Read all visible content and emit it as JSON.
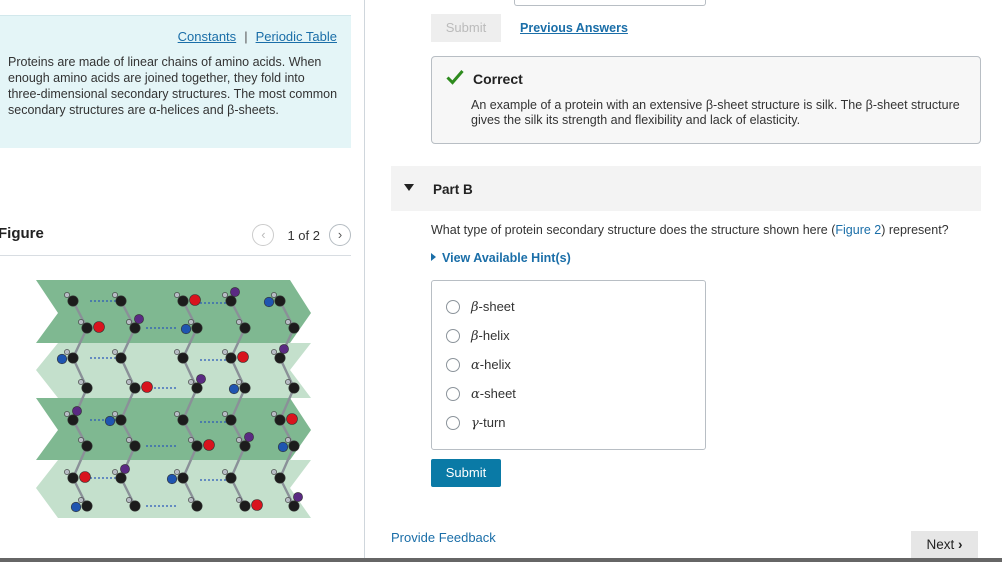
{
  "intro": {
    "links": [
      "Constants",
      "Periodic Table"
    ],
    "separator": "|",
    "text": "Proteins are made of linear chains of amino acids. When enough amino acids are joined together, they fold into three-dimensional secondary structures. The most common secondary structures are α-helices and β-sheets."
  },
  "figure": {
    "title": "Figure",
    "pager_text": "1 of 2",
    "prev_icon": "chevron-left-icon",
    "next_icon": "chevron-right-icon"
  },
  "part_a": {
    "submit_label": "Submit",
    "previous_answers_label": "Previous Answers",
    "feedback_icon": "checkmark-icon",
    "feedback_title": "Correct",
    "feedback_text": "An example of a protein with an extensive β-sheet structure is silk. The β-sheet structure gives the silk its strength and flexibility and lack of elasticity."
  },
  "part_b": {
    "label": "Part B",
    "question_before": "What type of protein secondary structure does the structure shown here (",
    "question_link": "Figure 2",
    "question_after": ") represent?",
    "hints_label": "View Available Hint(s)",
    "options": [
      {
        "greek": "β",
        "rest": "-sheet"
      },
      {
        "greek": "β",
        "rest": "-helix"
      },
      {
        "greek": "α",
        "rest": "-helix"
      },
      {
        "greek": "α",
        "rest": "-sheet"
      },
      {
        "greek": "γ",
        "rest": "-turn"
      }
    ],
    "submit_label": "Submit"
  },
  "footer": {
    "provide_feedback": "Provide Feedback",
    "next_label": "Next"
  },
  "colors": {
    "accent": "#0a7aa6",
    "link": "#1a6ea8",
    "correct": "#2e8b1e",
    "intro_bg": "#e4f5f7",
    "sheet_dark": "#7fb891",
    "sheet_light": "#c4e0cc"
  }
}
